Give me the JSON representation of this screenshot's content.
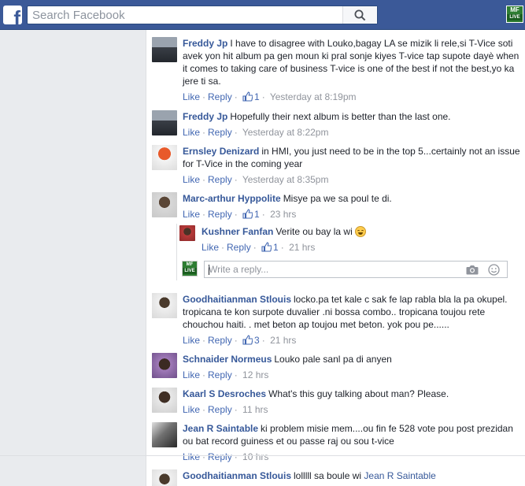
{
  "header": {
    "search_placeholder": "Search Facebook",
    "logo_letter": "f",
    "user_logo_text": "MF",
    "user_logo_sub": "LIVE"
  },
  "colors": {
    "brand": "#3b5998",
    "link": "#365899",
    "action": "#4267b2",
    "meta": "#90949c"
  },
  "comments": [
    {
      "author": "Freddy Jp",
      "text": "I have to disagree with Louko,bagay LA se mizik li rele,si T-Vice soti avek yon hit album pa gen moun ki pral sonje kiyes T-vice tap supote dayè when it comes to taking care of business T-vice is one of the best if not the best,yo ka jere ti sa.",
      "like": "Like",
      "reply": "Reply",
      "likes": "1",
      "time": "Yesterday at 8:19pm"
    },
    {
      "author": "Freddy Jp",
      "text": "Hopefully their next album is better than the last one.",
      "like": "Like",
      "reply": "Reply",
      "time": "Yesterday at 8:22pm"
    },
    {
      "author": "Ernsley Denizard",
      "text": "in HMI, you just need to be in the top 5...certainly not an issue for T-Vice in the coming year",
      "like": "Like",
      "reply": "Reply",
      "time": "Yesterday at 8:35pm"
    },
    {
      "author": "Marc-arthur Hyppolite",
      "text": "Misye pa we sa poul te di.",
      "like": "Like",
      "reply": "Reply",
      "likes": "1",
      "time": "23 hrs"
    },
    {
      "author": "Goodhaitianman Stlouis",
      "text": "locko.pa tet kale c sak fe lap rabla bla la pa okupel. tropicana te kon surpote duvalier .ni bossa combo.. tropicana toujou rete chouchou haiti. . met beton ap toujou met beton. yok pou pe......",
      "like": "Like",
      "reply": "Reply",
      "likes": "3",
      "time": "21 hrs"
    },
    {
      "author": "Schnaider Normeus",
      "text": "Louko pale sanl pa di anyen",
      "like": "Like",
      "reply": "Reply",
      "time": "12 hrs"
    },
    {
      "author": "Kaarl S Desroches",
      "text": "What's this guy talking about man? Please.",
      "like": "Like",
      "reply": "Reply",
      "time": "11 hrs"
    },
    {
      "author": "Jean R Saintable",
      "text": "ki problem misie mem....ou fin fe 528 vote pou post prezidan ou bat record guiness et ou passe raj ou sou t-vice",
      "like": "Like",
      "reply": "Reply",
      "time": "10 hrs"
    },
    {
      "author": "Goodhaitianman Stlouis",
      "text": "lolllll sa boule wi",
      "mention": "Jean R Saintable"
    }
  ],
  "nested_reply": {
    "author": "Kushner Fanfan",
    "text": "Verite ou bay la wi",
    "like": "Like",
    "reply": "Reply",
    "likes": "1",
    "time": "21 hrs"
  },
  "reply_form": {
    "placeholder": "Write a reply..."
  }
}
